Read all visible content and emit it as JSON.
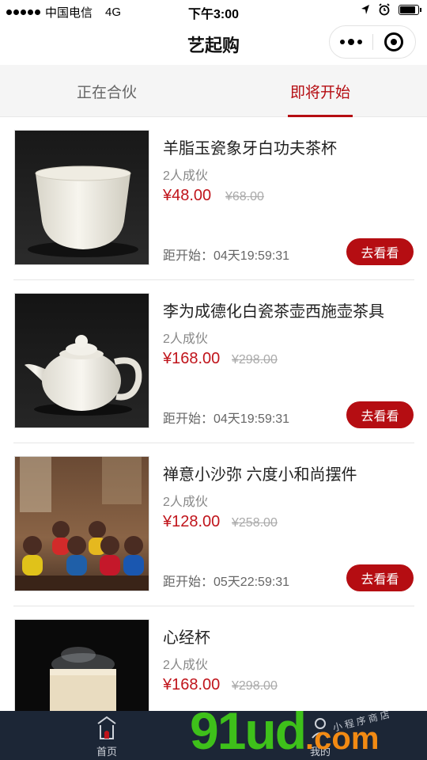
{
  "status_bar": {
    "carrier": "中国电信",
    "network": "4G",
    "time": "下午3:00"
  },
  "nav": {
    "title": "艺起购"
  },
  "tabs": [
    {
      "label": "正在合伙",
      "active": false
    },
    {
      "label": "即将开始",
      "active": true
    }
  ],
  "products": [
    {
      "title": "羊脂玉瓷象牙白功夫茶杯",
      "group": "2人成伙",
      "price": "¥48.00",
      "original_price": "¥68.00",
      "countdown": "距开始：04天19:59:31",
      "button": "去看看"
    },
    {
      "title": "李为成德化白瓷茶壶西施壶茶具",
      "group": "2人成伙",
      "price": "¥168.00",
      "original_price": "¥298.00",
      "countdown": "距开始：04天19:59:31",
      "button": "去看看"
    },
    {
      "title": "禅意小沙弥 六度小和尚摆件",
      "group": "2人成伙",
      "price": "¥128.00",
      "original_price": "¥258.00",
      "countdown": "距开始：05天22:59:31",
      "button": "去看看"
    },
    {
      "title": "心经杯",
      "group": "2人成伙",
      "price": "¥168.00",
      "original_price": "¥298.00"
    }
  ],
  "tabbar": {
    "home_label": "首页",
    "mine_label": "我的"
  },
  "watermark": {
    "text_green": "91ud",
    "text_orange": ".com",
    "note": "小 程 序 商 店"
  },
  "colors": {
    "accent": "#b50d12",
    "price": "#c0141b",
    "tabbar_bg": "#1c2636"
  }
}
